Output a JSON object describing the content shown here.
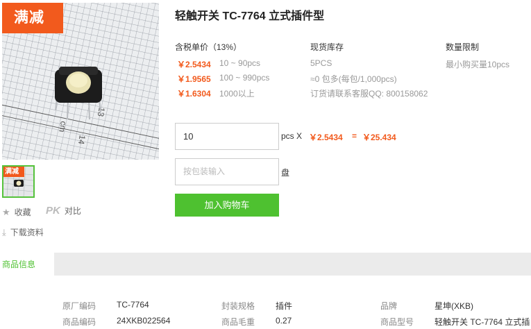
{
  "gallery": {
    "promo_badge": "满减",
    "thumb_badge": "满减"
  },
  "utilities": {
    "favorite": "收藏",
    "pk_label": "PK",
    "compare": "对比",
    "download": "下载资料"
  },
  "product": {
    "title": "轻触开关 TC-7764 立式插件型"
  },
  "pricing": {
    "header": "含税单价（13%）",
    "tiers": [
      {
        "price": "￥2.5434",
        "range": "10 ~ 90pcs"
      },
      {
        "price": "￥1.9565",
        "range": "100 ~ 990pcs"
      },
      {
        "price": "￥1.6304",
        "range": "1000以上"
      }
    ]
  },
  "stock": {
    "header": "现货库存",
    "lines": [
      "5PCS",
      "≈0 包多(每包/1,000pcs)",
      "订货请联系客服QQ: 800158062"
    ]
  },
  "limit": {
    "header": "数量限制",
    "text": "最小购买量10pcs"
  },
  "order": {
    "quantity_value": "10",
    "quantity_unit": "pcs X",
    "unit_price": "￥2.5434",
    "equals": "=",
    "total": "￥25.434",
    "pack_placeholder": "按包装输入",
    "pack_unit": "盘",
    "add_to_cart": "加入购物车"
  },
  "tabs": {
    "active": "商品信息"
  },
  "specs": [
    {
      "k": "原厂编码",
      "v": "TC-7764"
    },
    {
      "k": "封装规格",
      "v": "插件"
    },
    {
      "k": "品牌",
      "v": "星坤(XKB)"
    },
    {
      "k": "商品编码",
      "v": "24XKB022564"
    },
    {
      "k": "商品毛重",
      "v": "0.27"
    },
    {
      "k": "商品型号",
      "v": "轻触开关 TC-7764 立式插"
    }
  ],
  "colors": {
    "accent_orange": "#f25a1d",
    "cart_green": "#4ec130"
  }
}
